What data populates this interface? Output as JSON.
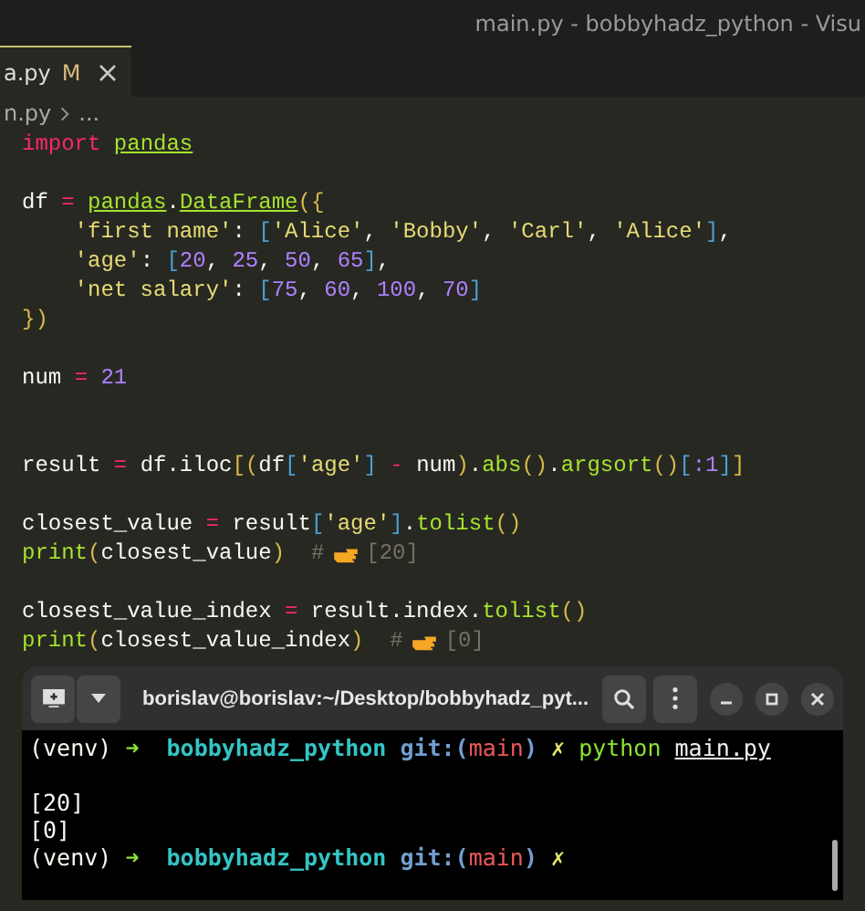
{
  "window": {
    "title": "main.py - bobbyhadz_python - Visu"
  },
  "tab": {
    "label": "a.py",
    "badge": "M"
  },
  "breadcrumb": {
    "file": "n.py",
    "rest": "..."
  },
  "code_lines": [
    {
      "kind": "code",
      "tokens": [
        {
          "kind": "kw",
          "text": "import "
        },
        {
          "kind": "mod",
          "text": "pandas"
        }
      ]
    },
    {
      "kind": "blank"
    },
    {
      "kind": "code",
      "tokens": [
        {
          "kind": "plain",
          "text": "df "
        },
        {
          "kind": "kw",
          "text": "= "
        },
        {
          "kind": "mod",
          "text": "pandas"
        },
        {
          "kind": "plain",
          "text": "."
        },
        {
          "kind": "mod",
          "text": "DataFrame"
        },
        {
          "kind": "brace",
          "text": "({"
        }
      ]
    },
    {
      "kind": "code",
      "tokens": [
        {
          "kind": "str",
          "text": "    'first name'"
        },
        {
          "kind": "plain",
          "text": ": "
        },
        {
          "kind": "br",
          "text": "["
        },
        {
          "kind": "str",
          "text": "'Alice'"
        },
        {
          "kind": "plain",
          "text": ", "
        },
        {
          "kind": "str",
          "text": "'Bobby'"
        },
        {
          "kind": "plain",
          "text": ", "
        },
        {
          "kind": "str",
          "text": "'Carl'"
        },
        {
          "kind": "plain",
          "text": ", "
        },
        {
          "kind": "str",
          "text": "'Alice'"
        },
        {
          "kind": "br",
          "text": "]"
        },
        {
          "kind": "plain",
          "text": ","
        }
      ]
    },
    {
      "kind": "code",
      "tokens": [
        {
          "kind": "str",
          "text": "    'age'"
        },
        {
          "kind": "plain",
          "text": ": "
        },
        {
          "kind": "br",
          "text": "["
        },
        {
          "kind": "num",
          "text": "20"
        },
        {
          "kind": "plain",
          "text": ", "
        },
        {
          "kind": "num",
          "text": "25"
        },
        {
          "kind": "plain",
          "text": ", "
        },
        {
          "kind": "num",
          "text": "50"
        },
        {
          "kind": "plain",
          "text": ", "
        },
        {
          "kind": "num",
          "text": "65"
        },
        {
          "kind": "br",
          "text": "]"
        },
        {
          "kind": "plain",
          "text": ","
        }
      ]
    },
    {
      "kind": "code",
      "tokens": [
        {
          "kind": "str",
          "text": "    'net salary'"
        },
        {
          "kind": "plain",
          "text": ": "
        },
        {
          "kind": "br",
          "text": "["
        },
        {
          "kind": "num",
          "text": "75"
        },
        {
          "kind": "plain",
          "text": ", "
        },
        {
          "kind": "num",
          "text": "60"
        },
        {
          "kind": "plain",
          "text": ", "
        },
        {
          "kind": "num",
          "text": "100"
        },
        {
          "kind": "plain",
          "text": ", "
        },
        {
          "kind": "num",
          "text": "70"
        },
        {
          "kind": "br",
          "text": "]"
        }
      ]
    },
    {
      "kind": "code",
      "tokens": [
        {
          "kind": "brace",
          "text": "})"
        }
      ]
    },
    {
      "kind": "blank"
    },
    {
      "kind": "code",
      "tokens": [
        {
          "kind": "plain",
          "text": "num "
        },
        {
          "kind": "kw",
          "text": "= "
        },
        {
          "kind": "num",
          "text": "21"
        }
      ]
    },
    {
      "kind": "blank"
    },
    {
      "kind": "blank"
    },
    {
      "kind": "code",
      "tokens": [
        {
          "kind": "plain",
          "text": "result "
        },
        {
          "kind": "kw",
          "text": "="
        },
        {
          "kind": "plain",
          "text": " df.iloc"
        },
        {
          "kind": "brace",
          "text": "[("
        },
        {
          "kind": "plain",
          "text": "df"
        },
        {
          "kind": "br",
          "text": "["
        },
        {
          "kind": "str",
          "text": "'age'"
        },
        {
          "kind": "br",
          "text": "] "
        },
        {
          "kind": "kw",
          "text": "-"
        },
        {
          "kind": "plain",
          "text": " num"
        },
        {
          "kind": "brace",
          "text": ")"
        },
        {
          "kind": "plain",
          "text": "."
        },
        {
          "kind": "fn",
          "text": "abs"
        },
        {
          "kind": "brace",
          "text": "()"
        },
        {
          "kind": "plain",
          "text": "."
        },
        {
          "kind": "fn",
          "text": "argsort"
        },
        {
          "kind": "brace",
          "text": "()"
        },
        {
          "kind": "br",
          "text": "["
        },
        {
          "kind": "num",
          "text": ":1"
        },
        {
          "kind": "br",
          "text": "]"
        },
        {
          "kind": "brace",
          "text": "]"
        }
      ]
    },
    {
      "kind": "blank"
    },
    {
      "kind": "code",
      "tokens": [
        {
          "kind": "plain",
          "text": "closest_value "
        },
        {
          "kind": "kw",
          "text": "="
        },
        {
          "kind": "plain",
          "text": " result"
        },
        {
          "kind": "br",
          "text": "["
        },
        {
          "kind": "str",
          "text": "'age'"
        },
        {
          "kind": "br",
          "text": "]"
        },
        {
          "kind": "plain",
          "text": "."
        },
        {
          "kind": "fn",
          "text": "tolist"
        },
        {
          "kind": "brace",
          "text": "()"
        }
      ]
    },
    {
      "kind": "code",
      "tokens": [
        {
          "kind": "fn",
          "text": "print"
        },
        {
          "kind": "brace",
          "text": "("
        },
        {
          "kind": "plain",
          "text": "closest_value"
        },
        {
          "kind": "brace",
          "text": ")"
        },
        {
          "kind": "cm",
          "text": "  #"
        },
        {
          "kind": "hand"
        },
        {
          "kind": "cm",
          "text": "[20]"
        }
      ]
    },
    {
      "kind": "blank"
    },
    {
      "kind": "code",
      "tokens": [
        {
          "kind": "plain",
          "text": "closest_value_index "
        },
        {
          "kind": "kw",
          "text": "="
        },
        {
          "kind": "plain",
          "text": " result.index."
        },
        {
          "kind": "fn",
          "text": "tolist"
        },
        {
          "kind": "brace",
          "text": "()"
        }
      ]
    },
    {
      "kind": "code",
      "tokens": [
        {
          "kind": "fn",
          "text": "print"
        },
        {
          "kind": "brace",
          "text": "("
        },
        {
          "kind": "plain",
          "text": "closest_value_index"
        },
        {
          "kind": "brace",
          "text": ")"
        },
        {
          "kind": "cm",
          "text": "  #"
        },
        {
          "kind": "hand"
        },
        {
          "kind": "cm",
          "text": "[0]"
        }
      ]
    }
  ],
  "terminal": {
    "title": "borislav@borislav:~/Desktop/bobbyhadz_pyt...",
    "lines": [
      {
        "kind": "output",
        "tokens": [
          {
            "kind": "plain",
            "text": "(venv) "
          },
          {
            "kind": "arrow",
            "text": "➜  "
          },
          {
            "kind": "dir",
            "text": "bobbyhadz_python "
          },
          {
            "kind": "git",
            "text": "git:("
          },
          {
            "kind": "branch",
            "text": "main"
          },
          {
            "kind": "git",
            "text": ") "
          },
          {
            "kind": "dirty",
            "text": "✗ "
          },
          {
            "kind": "cmd",
            "text": "python "
          },
          {
            "kind": "file",
            "text": "main.py"
          }
        ]
      },
      {
        "kind": "blank"
      },
      {
        "kind": "output",
        "tokens": [
          {
            "kind": "plain",
            "text": "[20]"
          }
        ]
      },
      {
        "kind": "output",
        "tokens": [
          {
            "kind": "plain",
            "text": "[0]"
          }
        ]
      },
      {
        "kind": "output",
        "tokens": [
          {
            "kind": "plain",
            "text": "(venv) "
          },
          {
            "kind": "arrow",
            "text": "➜  "
          },
          {
            "kind": "dir",
            "text": "bobbyhadz_python "
          },
          {
            "kind": "git",
            "text": "git:("
          },
          {
            "kind": "branch",
            "text": "main"
          },
          {
            "kind": "git",
            "text": ") "
          },
          {
            "kind": "dirty",
            "text": "✗"
          }
        ]
      }
    ]
  }
}
